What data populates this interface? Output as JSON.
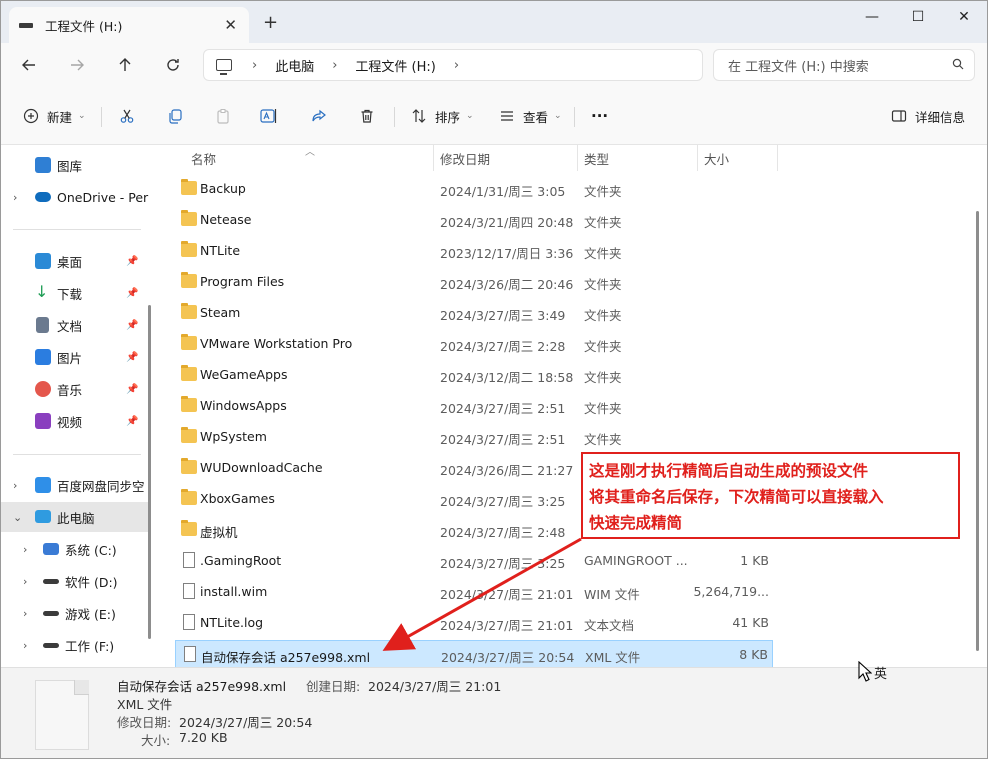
{
  "window": {
    "tab_title": "工程文件 (H:)",
    "new_tab": "+",
    "min": "—",
    "max": "☐",
    "close": "✕"
  },
  "address": {
    "crumbs": [
      "此电脑",
      "工程文件 (H:)"
    ],
    "search_placeholder": "在 工程文件 (H:) 中搜索"
  },
  "toolbar": {
    "new_label": "新建",
    "sort_label": "排序",
    "view_label": "查看",
    "more_label": "···",
    "details_label": "详细信息"
  },
  "sidebar": {
    "items": [
      {
        "label": "图库",
        "icon": "gallery-icon",
        "color": "#2f7fd4"
      },
      {
        "label": "OneDrive - Per",
        "icon": "cloud-icon",
        "color": "#0f6cbd"
      },
      {
        "label": "桌面",
        "icon": "desktop-icon",
        "color": "#2b8ad6"
      },
      {
        "label": "下载",
        "icon": "download-icon",
        "color": "#1f9d55"
      },
      {
        "label": "文档",
        "icon": "document-icon",
        "color": "#6b7a8f"
      },
      {
        "label": "图片",
        "icon": "picture-icon",
        "color": "#2b7de0"
      },
      {
        "label": "音乐",
        "icon": "music-icon",
        "color": "#e4574c"
      },
      {
        "label": "视频",
        "icon": "video-icon",
        "color": "#8a3fbf"
      },
      {
        "label": "百度网盘同步空",
        "icon": "baidu-icon",
        "color": "#2f8fe8"
      },
      {
        "label": "此电脑",
        "icon": "computer-icon",
        "color": "#2f9be0"
      },
      {
        "label": "系统 (C:)",
        "icon": "windows-drive-icon",
        "color": "#3a7bd5"
      },
      {
        "label": "软件 (D:)",
        "icon": "drive-icon",
        "color": "#3b3b3b"
      },
      {
        "label": "游戏 (E:)",
        "icon": "drive-icon",
        "color": "#3b3b3b"
      },
      {
        "label": "工作 (F:)",
        "icon": "drive-icon",
        "color": "#3b3b3b"
      }
    ]
  },
  "columns": {
    "name": "名称",
    "date": "修改日期",
    "type": "类型",
    "size": "大小"
  },
  "files": [
    {
      "name": "Backup",
      "date": "2024/1/31/周三 3:05",
      "type": "文件夹",
      "size": "",
      "kind": "folder"
    },
    {
      "name": "Netease",
      "date": "2024/3/21/周四 20:48",
      "type": "文件夹",
      "size": "",
      "kind": "folder"
    },
    {
      "name": "NTLite",
      "date": "2023/12/17/周日 3:36",
      "type": "文件夹",
      "size": "",
      "kind": "folder"
    },
    {
      "name": "Program Files",
      "date": "2024/3/26/周二 20:46",
      "type": "文件夹",
      "size": "",
      "kind": "folder"
    },
    {
      "name": "Steam",
      "date": "2024/3/27/周三 3:49",
      "type": "文件夹",
      "size": "",
      "kind": "folder"
    },
    {
      "name": "VMware Workstation Pro",
      "date": "2024/3/27/周三 2:28",
      "type": "文件夹",
      "size": "",
      "kind": "folder"
    },
    {
      "name": "WeGameApps",
      "date": "2024/3/12/周二 18:58",
      "type": "文件夹",
      "size": "",
      "kind": "folder"
    },
    {
      "name": "WindowsApps",
      "date": "2024/3/27/周三 2:51",
      "type": "文件夹",
      "size": "",
      "kind": "folder"
    },
    {
      "name": "WpSystem",
      "date": "2024/3/27/周三 2:51",
      "type": "文件夹",
      "size": "",
      "kind": "folder"
    },
    {
      "name": "WUDownloadCache",
      "date": "2024/3/26/周二 21:27",
      "type": "文件夹",
      "size": "",
      "kind": "folder"
    },
    {
      "name": "XboxGames",
      "date": "2024/3/27/周三 3:25",
      "type": "文件夹",
      "size": "",
      "kind": "folder"
    },
    {
      "name": "虚拟机",
      "date": "2024/3/27/周三 2:48",
      "type": "文件夹",
      "size": "",
      "kind": "folder"
    },
    {
      "name": ".GamingRoot",
      "date": "2024/3/27/周三 3:25",
      "type": "GAMINGROOT ...",
      "size": "1 KB",
      "kind": "file"
    },
    {
      "name": "install.wim",
      "date": "2024/3/27/周三 21:01",
      "type": "WIM 文件",
      "size": "5,264,719...",
      "kind": "file"
    },
    {
      "name": "NTLite.log",
      "date": "2024/3/27/周三 21:01",
      "type": "文本文档",
      "size": "41 KB",
      "kind": "file"
    },
    {
      "name": "自动保存会话 a257e998.xml",
      "date": "2024/3/27/周三 20:54",
      "type": "XML 文件",
      "size": "8 KB",
      "kind": "file",
      "selected": true
    }
  ],
  "details": {
    "filename": "自动保存会话 a257e998.xml",
    "created_label": "创建日期:",
    "created_value": "2024/3/27/周三 21:01",
    "type": "XML 文件",
    "modified_label": "修改日期:",
    "modified_value": "2024/3/27/周三 20:54",
    "size_label": "大小:",
    "size_value": "7.20 KB"
  },
  "annotation": {
    "line1": "这是刚才执行精简后自动生成的预设文件",
    "line2": "将其重命名后保存，下次精简可以直接载入",
    "line3": "快速完成精简",
    "color": "#e0201c"
  },
  "ime_indicator": "英"
}
